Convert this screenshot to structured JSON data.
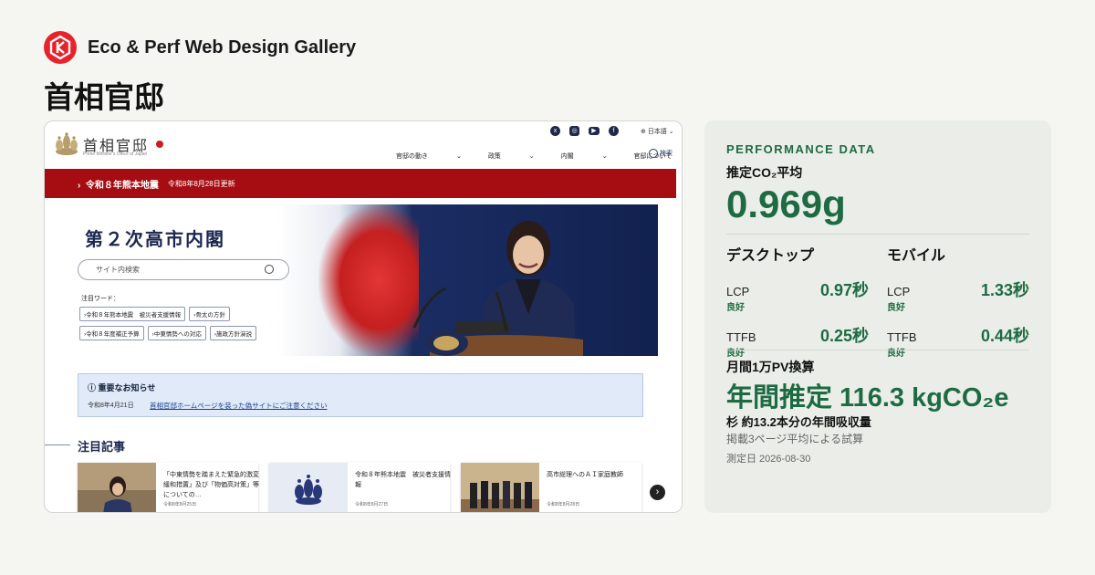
{
  "brand": {
    "name": "Eco & Perf Web Design Gallery",
    "accent": "#e8222b"
  },
  "page_title": "首相官邸",
  "screenshot": {
    "site_name": "首相官邸",
    "site_sub": "Prime Minister's Office of Japan",
    "social_icons": [
      "x-icon",
      "instagram-icon",
      "youtube-icon",
      "facebook-icon"
    ],
    "language": "日本語",
    "nav": [
      "官邸の動き",
      "政策",
      "内閣",
      "官邸について"
    ],
    "search_label": "検索",
    "alert": {
      "title": "令和８年熊本地震",
      "date": "令和8年8月28日更新"
    },
    "hero": {
      "heading": "第２次高市内閣",
      "search_placeholder": "サイト内検索",
      "keywords_label": "注目ワード：",
      "tags": [
        "令和８年熊本地震　被災者支援情報",
        "骨太の方針",
        "令和８年度補正予算",
        "中東情勢への対応",
        "施政方針演説"
      ]
    },
    "notice": {
      "title": "重要なお知らせ",
      "date": "令和8年4月21日",
      "link": "首相官邸ホームページを装った偽サイトにご注意ください"
    },
    "featured_title": "注目記事",
    "cards": [
      {
        "text": "「中東情勢を踏まえた緊急的激変緩和措置」及び「物価高対策」等についての…",
        "date": "令和8年8月25日"
      },
      {
        "text": "令和８年熊本地震　被災者支援情報",
        "date": "令和8年8月27日"
      },
      {
        "text": "高市総理へのＡＩ家庭教師",
        "date": "令和8年8月28日"
      }
    ]
  },
  "performance": {
    "label": "PERFORMANCE DATA",
    "co2_label": "推定CO₂平均",
    "co2_value": "0.969g",
    "desktop": {
      "title": "デスクトップ",
      "lcp_label": "LCP",
      "lcp_value": "0.97秒",
      "lcp_rating": "良好",
      "ttfb_label": "TTFB",
      "ttfb_value": "0.25秒",
      "ttfb_rating": "良好"
    },
    "mobile": {
      "title": "モバイル",
      "lcp_label": "LCP",
      "lcp_value": "1.33秒",
      "lcp_rating": "良好",
      "ttfb_label": "TTFB",
      "ttfb_value": "0.44秒",
      "ttfb_rating": "良好"
    },
    "monthly_label": "月間1万PV換算",
    "annual": "年間推定 116.3 kgCO₂e",
    "trees": "杉 約13.2本分の年間吸収量",
    "note": "掲載3ページ平均による試算",
    "measured": "測定日 2026-08-30"
  }
}
